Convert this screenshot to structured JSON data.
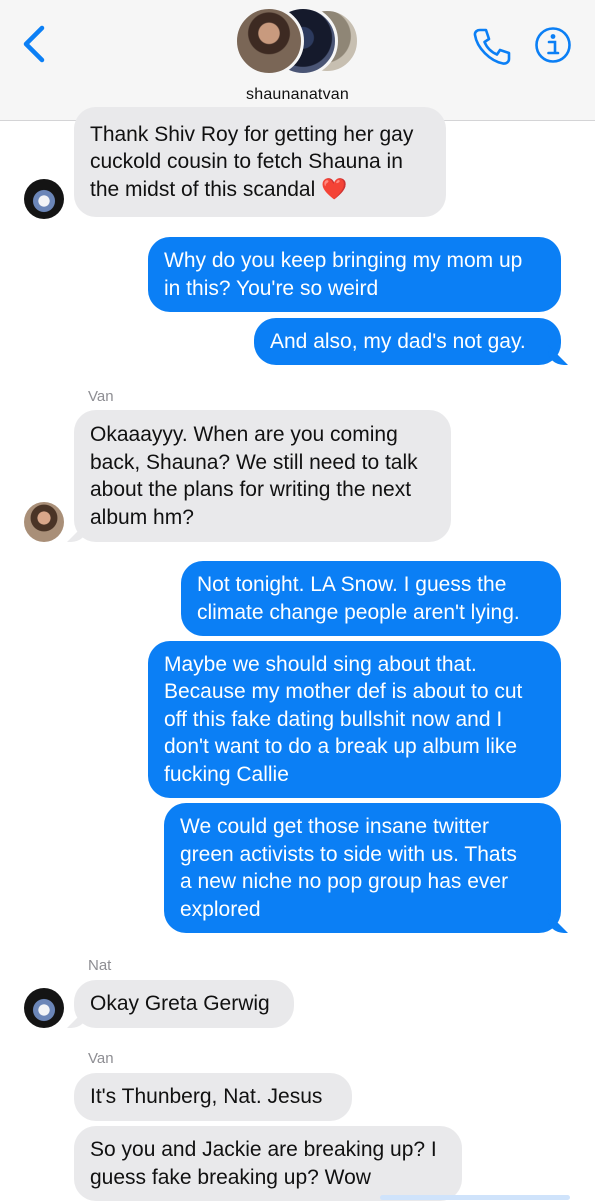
{
  "header": {
    "group_name": "shaunanatvan",
    "colors": {
      "accent": "#0b7ff5",
      "header_bg": "#f6f6f6"
    },
    "icons": {
      "back": "chevron-left-icon",
      "call": "phone-icon",
      "info": "info-icon"
    }
  },
  "messages": [
    {
      "kind": "received",
      "text": "Thank Shiv Roy for getting her gay\ncuckold cousin to fetch Shauna in\nthe midst of this scandal ❤️"
    },
    {
      "kind": "sent",
      "text": "Why do you keep bringing my mom up\nin this? You're so weird"
    },
    {
      "kind": "sent",
      "text": "And also, my dad's not gay."
    },
    {
      "kind": "sender",
      "text": "Van"
    },
    {
      "kind": "received",
      "text": "Okaaayyy. When are you coming\nback, Shauna? We still need to talk\nabout the plans for writing the next\nalbum hm?"
    },
    {
      "kind": "sent",
      "text": "Not tonight. LA Snow. I guess the\nclimate change people aren't lying."
    },
    {
      "kind": "sent",
      "text": "Maybe we should sing about that.\nBecause my mother def is about to cut\noff this fake dating bullshit now and I\ndon't want to do a break up album like\nfucking Callie"
    },
    {
      "kind": "sent",
      "text": "We could get those insane twitter\ngreen activists to side with us. Thats\na new niche no pop group has ever\nexplored"
    },
    {
      "kind": "sender",
      "text": "Nat"
    },
    {
      "kind": "received",
      "text": "Okay Greta Gerwig"
    },
    {
      "kind": "sender",
      "text": "Van"
    },
    {
      "kind": "received",
      "text": "It's Thunberg, Nat. Jesus"
    },
    {
      "kind": "received",
      "text": "So you and Jackie are breaking up? I\nguess fake breaking up? Wow"
    }
  ]
}
